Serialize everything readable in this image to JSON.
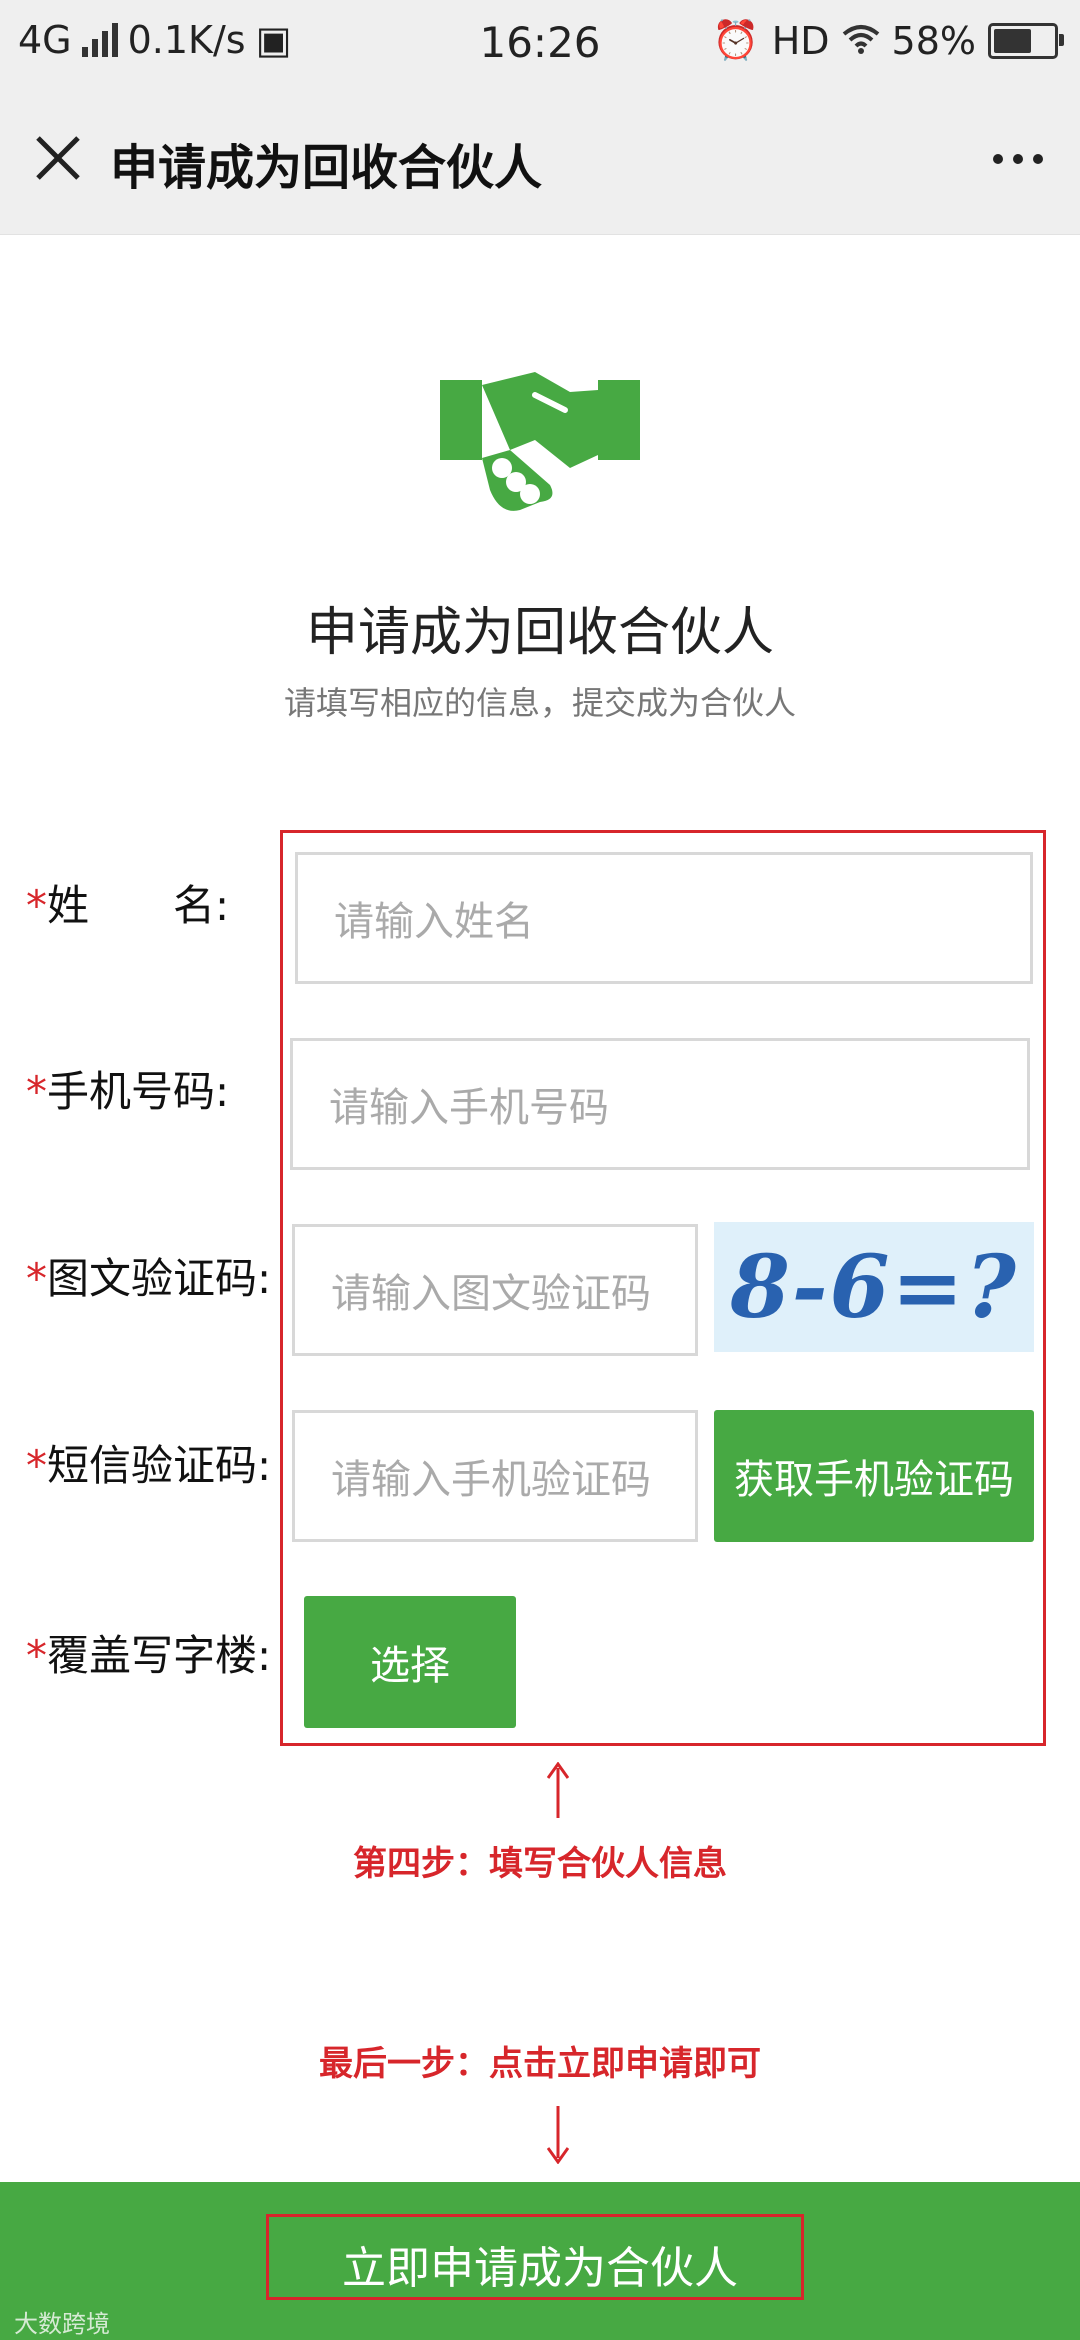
{
  "status_bar": {
    "network": "4G",
    "speed": "0.1K/s",
    "time": "16:26",
    "hd": "HD",
    "battery": "58%"
  },
  "header": {
    "title": "申请成为回收合伙人"
  },
  "hero": {
    "title": "申请成为回收合伙人",
    "subtitle": "请填写相应的信息，提交成为合伙人"
  },
  "form": {
    "required_mark": "*",
    "name": {
      "label": "姓　　名:",
      "placeholder": "请输入姓名"
    },
    "phone": {
      "label": "手机号码:",
      "placeholder": "请输入手机号码"
    },
    "captcha": {
      "label": "图文验证码:",
      "placeholder": "请输入图文验证码",
      "image_text": "8-6=?"
    },
    "sms": {
      "label": "短信验证码:",
      "placeholder": "请输入手机验证码",
      "button": "获取手机验证码"
    },
    "building": {
      "label": "覆盖写字楼:",
      "button": "选择"
    }
  },
  "notes": {
    "step4": "第四步：填写合伙人信息",
    "final": "最后一步：点击立即申请即可"
  },
  "submit": {
    "label": "立即申请成为合伙人"
  },
  "watermark": "大数跨境",
  "colors": {
    "accent_green": "#47a943",
    "annotation_red": "#d7262b"
  }
}
